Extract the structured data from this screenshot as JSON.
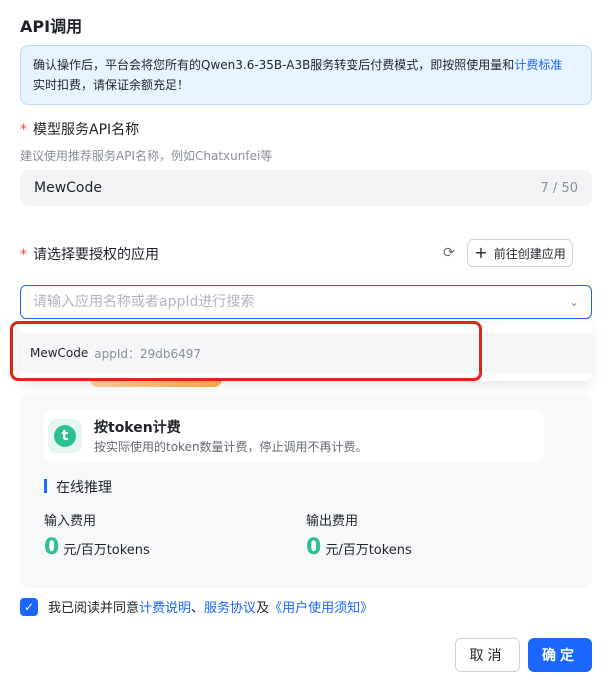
{
  "title": "API调用",
  "notice": {
    "text": "确认操作后，平台会将您所有的Qwen3.6-35B-A3B服务转变后付费模式，即按照使用量和",
    "link": "计费标准",
    "text2": "实时扣费，请保证余额充足！"
  },
  "api_name": {
    "label": "模型服务API名称",
    "hint": "建议使用推荐服务API名称，例如Chatxunfei等",
    "value": "MewCode",
    "count": "7 / 50"
  },
  "app_select": {
    "label": "请选择要授权的应用",
    "create_label": "前往创建应用",
    "placeholder": "请输入应用名称或者appId进行搜索",
    "options": [
      {
        "name": "MewCode",
        "appid": "appId：29db6497"
      }
    ]
  },
  "billing": {
    "token_title": "按token计费",
    "token_desc": "按实际使用的token数量计费，停止调用不再计费。",
    "section": "在线推理",
    "input_label": "输入费用",
    "input_value": "0",
    "input_unit": "元/百万tokens",
    "output_label": "输出费用",
    "output_value": "0",
    "output_unit": "元/百万tokens"
  },
  "agreement": {
    "prefix": "我已阅读并同意",
    "link1": "计费说明",
    "sep1": "、",
    "link2": "服务协议",
    "sep2": "及",
    "link3": "《用户使用须知》"
  },
  "buttons": {
    "cancel": "取消",
    "ok": "确定"
  },
  "icons": {
    "refresh": "refresh-icon",
    "plus": "plus-icon",
    "chevron": "chevron-down-icon",
    "token": "token-icon",
    "check": "check-icon"
  },
  "colors": {
    "accent": "#1a66ff",
    "fee": "#2fbf94",
    "highlight": "#e1251b"
  }
}
